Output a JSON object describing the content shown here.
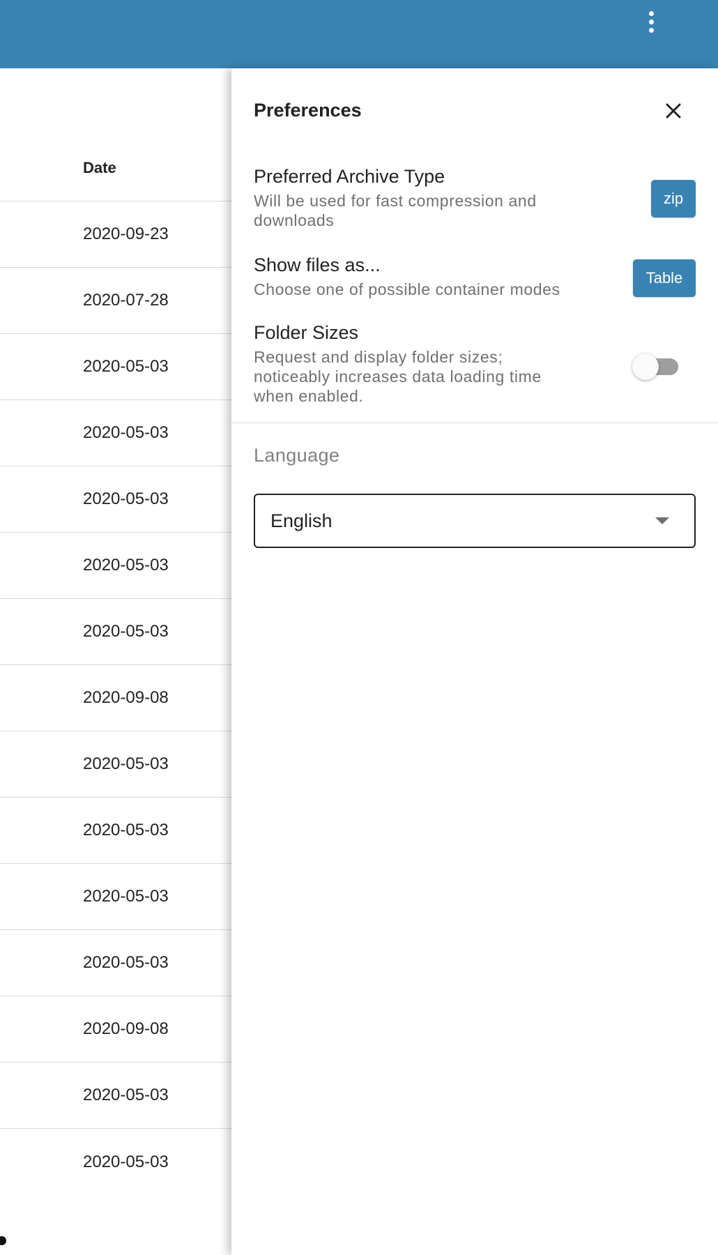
{
  "topbar": {
    "menu_icon": "more-vertical-icon",
    "color": "#3983b3"
  },
  "table": {
    "column_header": "Date",
    "rows": [
      "2020-09-23",
      "2020-07-28",
      "2020-05-03",
      "2020-05-03",
      "2020-05-03",
      "2020-05-03",
      "2020-05-03",
      "2020-09-08",
      "2020-05-03",
      "2020-05-03",
      "2020-05-03",
      "2020-05-03",
      "2020-09-08",
      "2020-05-03",
      "2020-05-03"
    ]
  },
  "preferences": {
    "title": "Preferences",
    "close_icon": "close-icon",
    "archive_type": {
      "title": "Preferred Archive Type",
      "description": "Will be used for fast compression and downloads",
      "value": "zip"
    },
    "show_files": {
      "title": "Show files as...",
      "description": "Choose one of possible container modes",
      "value": "Table"
    },
    "folder_sizes": {
      "title": "Folder Sizes",
      "description": "Request and display folder sizes; noticeably increases data loading time when enabled.",
      "enabled": false
    },
    "language": {
      "label": "Language",
      "selected": "English",
      "dropdown_icon": "caret-down-icon"
    }
  }
}
